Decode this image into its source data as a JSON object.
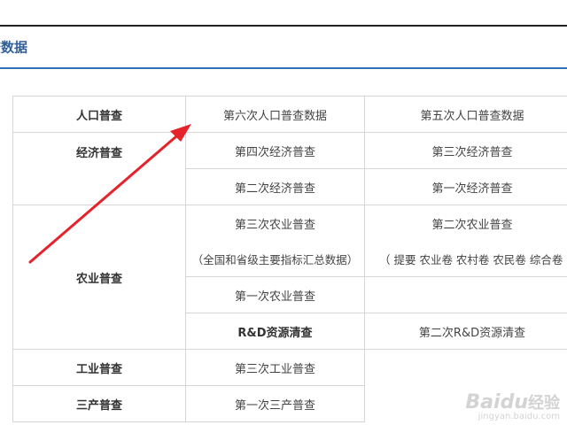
{
  "header": {
    "title": "查数据"
  },
  "table": {
    "population": {
      "category": "人口普查",
      "sixth": "第六次人口普查数据",
      "fifth": "第五次人口普查数据"
    },
    "economic": {
      "category": "经济普查",
      "fourth": "第四次经济普查",
      "third": "第三次经济普查",
      "second": "第二次经济普查",
      "first": "第一次经济普查"
    },
    "agriculture": {
      "category": "农业普查",
      "third": "第三次农业普查",
      "third_note": "（全国和省级主要指标汇总数据）",
      "second": "第二次农业普查",
      "second_note": "（ 提要  农业卷  农村卷  农民卷  综合卷",
      "first": "第一次农业普查"
    },
    "rd": {
      "category": "R&D资源清查",
      "second": "第二次R&D资源清查"
    },
    "industry": {
      "category": "工业普查",
      "third": "第三次工业普查"
    },
    "tertiary": {
      "category": "三产普查",
      "first": "第一次三产普查"
    }
  },
  "watermark": {
    "logo": "Baidu",
    "logo_zh": "经验",
    "url": "jingyan.baidu.com"
  },
  "colors": {
    "header_title": "#2f5f97",
    "header_rule": "#2f6fb5",
    "arrow": "#e5232b",
    "border": "#d7d7d7"
  }
}
